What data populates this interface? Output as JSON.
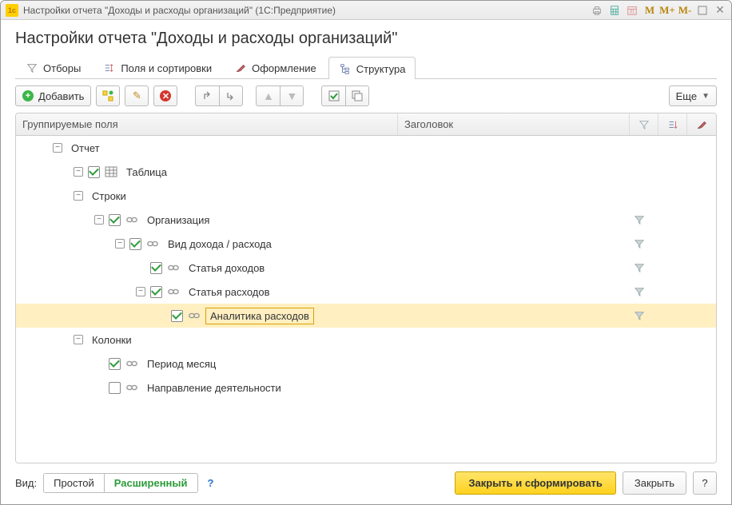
{
  "titlebar": {
    "title": "Настройки отчета \"Доходы и расходы организаций\"  (1С:Предприятие)",
    "m_buttons": [
      "M",
      "M+",
      "M-"
    ]
  },
  "heading": "Настройки отчета \"Доходы и расходы организаций\"",
  "tabs": [
    {
      "id": "filters",
      "label": "Отборы",
      "icon": "funnel-icon"
    },
    {
      "id": "fields",
      "label": "Поля и сортировки",
      "icon": "sort-fields-icon"
    },
    {
      "id": "appearance",
      "label": "Оформление",
      "icon": "brush-icon"
    },
    {
      "id": "structure",
      "label": "Структура",
      "icon": "tree-icon",
      "active": true
    }
  ],
  "toolbar": {
    "add_label": "Добавить",
    "more_label": "Еще"
  },
  "table": {
    "header_fields": "Группируемые поля",
    "header_title": "Заголовок"
  },
  "tree": [
    {
      "name": "report",
      "indent": 0,
      "exp": "minus",
      "chk": null,
      "ico": null,
      "label": "Отчет",
      "funnel": false
    },
    {
      "name": "table",
      "indent": 1,
      "exp": "minus",
      "chk": true,
      "ico": "table",
      "label": "Таблица",
      "funnel": false
    },
    {
      "name": "rows",
      "indent": 1,
      "exp": "minus",
      "chk": null,
      "ico": null,
      "label": "Строки",
      "funnel": false
    },
    {
      "name": "org",
      "indent": 2,
      "exp": "minus",
      "chk": true,
      "ico": "link",
      "label": "Организация",
      "funnel": true
    },
    {
      "name": "kind",
      "indent": 3,
      "exp": "minus",
      "chk": true,
      "ico": "link",
      "label": "Вид дохода / расхода",
      "funnel": true
    },
    {
      "name": "income",
      "indent": 4,
      "exp": "space",
      "chk": true,
      "ico": "link",
      "label": "Статья доходов",
      "funnel": true
    },
    {
      "name": "expense",
      "indent": 4,
      "exp": "minus",
      "chk": true,
      "ico": "link",
      "label": "Статья расходов",
      "funnel": true
    },
    {
      "name": "analytics",
      "indent": 5,
      "exp": "space",
      "chk": true,
      "ico": "link",
      "label": "Аналитика расходов",
      "funnel": true,
      "selected": true
    },
    {
      "name": "cols",
      "indent": 1,
      "exp": "minus",
      "chk": null,
      "ico": null,
      "label": "Колонки",
      "funnel": false
    },
    {
      "name": "period",
      "indent": 2,
      "exp": "space",
      "chk": true,
      "ico": "link",
      "label": "Период месяц",
      "funnel": false
    },
    {
      "name": "activity",
      "indent": 2,
      "exp": "space",
      "chk": false,
      "ico": "link",
      "label": "Направление деятельности",
      "funnel": false
    }
  ],
  "footer": {
    "view_label": "Вид:",
    "simple": "Простой",
    "advanced": "Расширенный",
    "close_and_form": "Закрыть и сформировать",
    "close": "Закрыть",
    "help": "?"
  }
}
